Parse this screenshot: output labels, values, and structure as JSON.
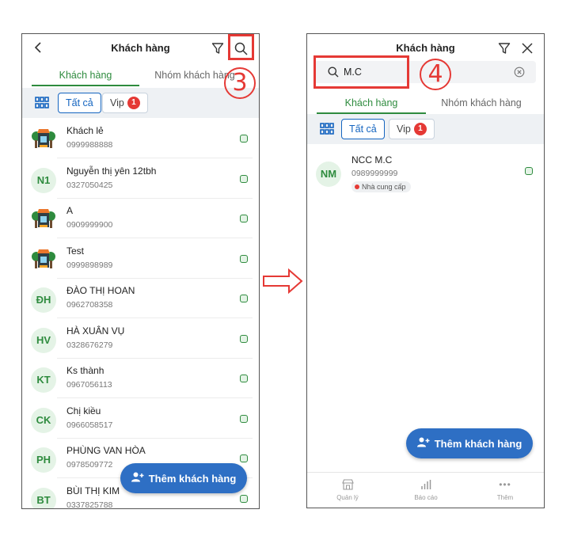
{
  "left": {
    "title": "Khách hàng",
    "callout": "3",
    "tabs": [
      "Khách hàng",
      "Nhóm khách hàng"
    ],
    "chips": {
      "all": "Tất cả",
      "vip": "Vip",
      "vip_badge": "1"
    },
    "customers": [
      {
        "initials": "",
        "icon": "store-icon",
        "name": "Khách lẻ",
        "phone": "0999988888"
      },
      {
        "initials": "N1",
        "name": "Nguyễn thị yên 12tbh",
        "phone": "0327050425"
      },
      {
        "initials": "",
        "icon": "store-icon",
        "name": "A",
        "phone": "0909999900"
      },
      {
        "initials": "",
        "icon": "store-icon",
        "name": "Test",
        "phone": "0999898989"
      },
      {
        "initials": "ĐH",
        "name": "ĐÀO THỊ HOAN",
        "phone": "0962708358"
      },
      {
        "initials": "HV",
        "name": "HÀ XUÂN VỤ",
        "phone": "0328676279"
      },
      {
        "initials": "KT",
        "name": "Ks thành",
        "phone": "0967056113"
      },
      {
        "initials": "CK",
        "name": "Chị kiều",
        "phone": "0966058517"
      },
      {
        "initials": "PH",
        "name": "PHÙNG VAN HÒA",
        "phone": "0978509772"
      },
      {
        "initials": "BT",
        "name": "BÙI THỊ KIM",
        "phone": "0337825788"
      }
    ],
    "fab": "Thêm khách hàng"
  },
  "right": {
    "title": "Khách hàng",
    "search_value": "M.C",
    "callout": "4",
    "tabs": [
      "Khách hàng",
      "Nhóm khách hàng"
    ],
    "chips": {
      "all": "Tất cả",
      "vip": "Vip",
      "vip_badge": "1"
    },
    "result": {
      "initials": "NM",
      "name": "NCC M.C",
      "phone": "0989999999",
      "tag": "Nhà cung cấp"
    },
    "fab": "Thêm khách hàng",
    "nav": [
      "Quản lý",
      "Báo cáo",
      "Thêm"
    ]
  },
  "colors": {
    "accent": "#2e8b3e",
    "fab": "#2e6fc4",
    "annotation": "#e53935"
  }
}
